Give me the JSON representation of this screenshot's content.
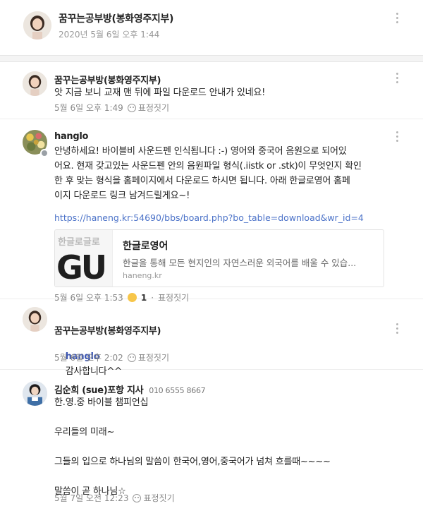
{
  "post": {
    "author": "꿈꾸는공부방(봉화영주지부)",
    "date": "2020년 5월 6일 오후 1:44"
  },
  "comments": [
    {
      "author": "꿈꾸는공부방(봉화영주지부)",
      "text": "앗 지금 보니 교재 맨 뒤에 파일 다운로드 안내가 있네요!",
      "time": "5월 6일 오후 1:49",
      "react_label": "표정짓기"
    },
    {
      "author": "hanglo",
      "text": "안녕하세요! 바이블비 사운드펜 인식됩니다 :-) 영어와 중국어 음원으로 되어있\n어요. 현재 갖고있는 사운드펜 안의 음원파일 형식(.iistk or .stk)이 무엇인지 확인\n한 후 맞는 형식을 홈페이지에서 다운로드 하시면 됩니다. 아래 한글로영어 홈페\n이지 다운로드 링크 남겨드릴게요~!",
      "link": "https://haneng.kr:54690/bbs/board.php?bo_table=download&wr_id=4",
      "preview": {
        "title": "한글로영어",
        "description": "한글을 통해 모든 현지인의 자연스러운 외국어를 배울 수 있습...",
        "domain": "haneng.kr",
        "thumb_text": "한글로글로",
        "thumb_big": "GU"
      },
      "time": "5월 6일 오후 1:53",
      "reaction_count": "1",
      "react_label": "표정짓기"
    },
    {
      "author": "꿈꾸는공부방(봉화영주지부)",
      "mention": "hanglo",
      "text": "감사합니다^^",
      "time": "5월 6일 오후 2:02",
      "react_label": "표정짓기"
    },
    {
      "author": "김순희 (sue)포항 지사",
      "phone": "010 6555 8667",
      "text": "한.영.중 바이블 챔피언십\n\n우리들의 미래~\n\n그들의 입으로 하나님의 말씀이 한국어,영어,중국어가 넘쳐 흐를때~~~~\n\n말씀이 곧 하나님☆",
      "time": "5월 7일 오전 12:23",
      "react_label": "표정짓기"
    }
  ],
  "colors": {
    "link": "#4b72c8",
    "mention": "#3b56b4",
    "muted": "#888888"
  }
}
